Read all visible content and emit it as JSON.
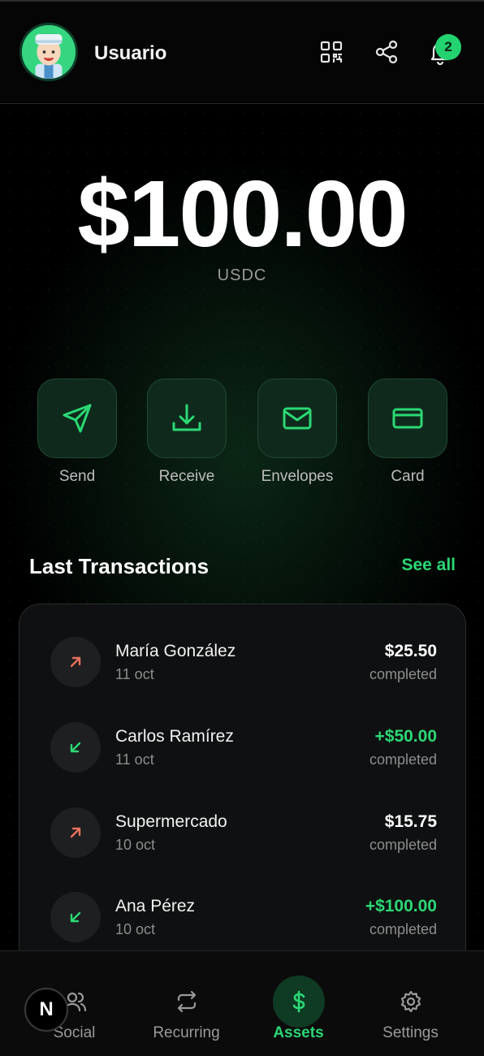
{
  "header": {
    "username": "Usuario",
    "notification_count": "2",
    "icons": [
      "qr-code-icon",
      "share-icon",
      "bell-icon"
    ]
  },
  "balance": {
    "amount": "$100.00",
    "currency": "USDC"
  },
  "actions": [
    {
      "label": "Send",
      "icon": "send-icon"
    },
    {
      "label": "Receive",
      "icon": "download-icon"
    },
    {
      "label": "Envelopes",
      "icon": "envelope-icon"
    },
    {
      "label": "Card",
      "icon": "credit-card-icon"
    }
  ],
  "transactions": {
    "title": "Last Transactions",
    "see_all": "See all",
    "items": [
      {
        "name": "María González",
        "date": "11 oct",
        "amount": "$25.50",
        "status": "completed",
        "direction": "out"
      },
      {
        "name": "Carlos Ramírez",
        "date": "11 oct",
        "amount": "+$50.00",
        "status": "completed",
        "direction": "in"
      },
      {
        "name": "Supermercado",
        "date": "10 oct",
        "amount": "$15.75",
        "status": "completed",
        "direction": "out"
      },
      {
        "name": "Ana Pérez",
        "date": "10 oct",
        "amount": "+$100.00",
        "status": "completed",
        "direction": "in"
      }
    ]
  },
  "nav": [
    {
      "label": "Social",
      "icon": "users-icon",
      "active": false
    },
    {
      "label": "Recurring",
      "icon": "repeat-icon",
      "active": false
    },
    {
      "label": "Assets",
      "icon": "dollar-icon",
      "active": true
    },
    {
      "label": "Settings",
      "icon": "gear-icon",
      "active": false
    }
  ],
  "fab_letter": "N",
  "colors": {
    "accent": "#2bd874",
    "outgoing": "#e8705f",
    "background": "#000000",
    "card": "#0f1011"
  }
}
